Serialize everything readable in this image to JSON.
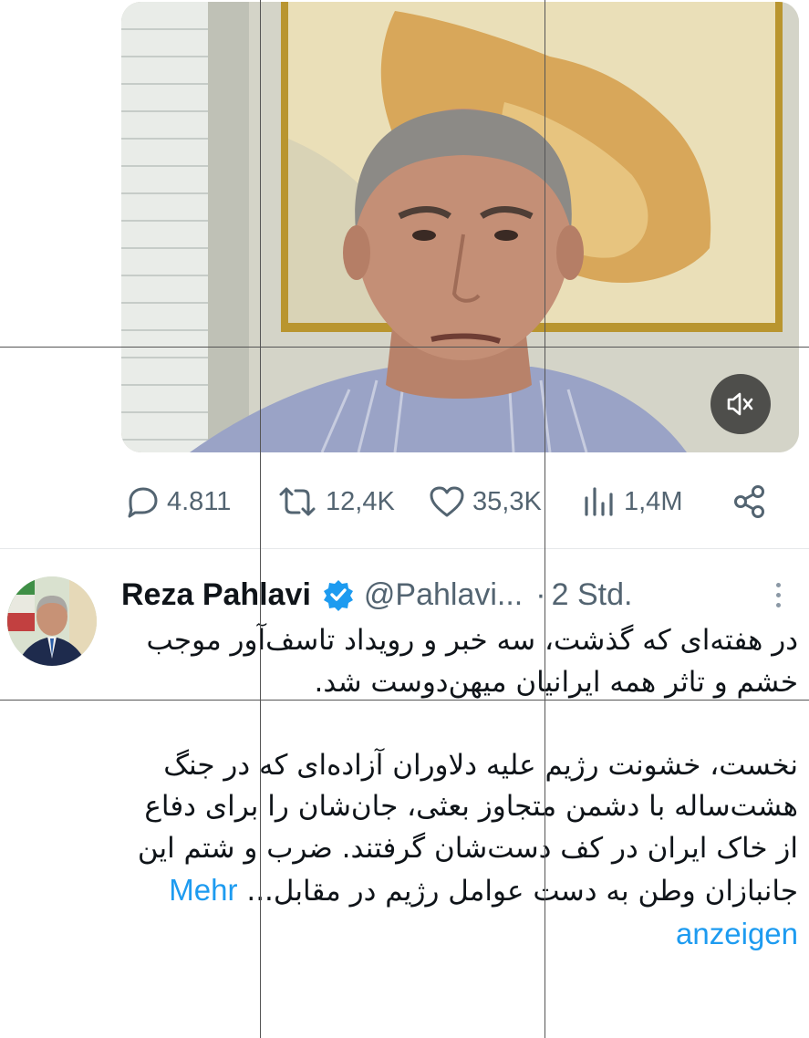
{
  "media": {
    "type": "video",
    "mute_icon": "speaker-muted-icon"
  },
  "actions": {
    "replies": {
      "icon": "reply-icon",
      "count": "4.811"
    },
    "reposts": {
      "icon": "repost-icon",
      "count": "12,4K"
    },
    "likes": {
      "icon": "heart-icon",
      "count": "35,3K"
    },
    "views": {
      "icon": "views-icon",
      "count": "1,4M"
    },
    "share": {
      "icon": "share-icon"
    }
  },
  "tweet": {
    "author_name": "Reza Pahlavi",
    "verified_icon": "verified-badge-icon",
    "handle": "@Pahlavi...",
    "separator": "·",
    "time": "2 Std.",
    "more_icon": "more-vertical-icon",
    "paragraph_1": "در هفته‌ای که گذشت، سه خبر و رویداد تاسف‌آور موجب خشم و تاثر همه ایرانیان میهن‌دوست شد.",
    "paragraph_2": "نخست، خشونت رژیم علیه دلاوران آزاده‌ای که در جنگ هشت‌ساله با دشمن متجاوز بعثی، جان‌شان را برای دفاع از خاک ایران در کف دست‌شان گرفتند. ضرب و شتم این جانبازان وطن به دست عوامل رژیم در مقابل...",
    "show_more": "Mehr anzeigen"
  },
  "colors": {
    "text": "#0f1419",
    "muted": "#536471",
    "link": "#1d9bf0",
    "verified": "#1d9bf0"
  }
}
